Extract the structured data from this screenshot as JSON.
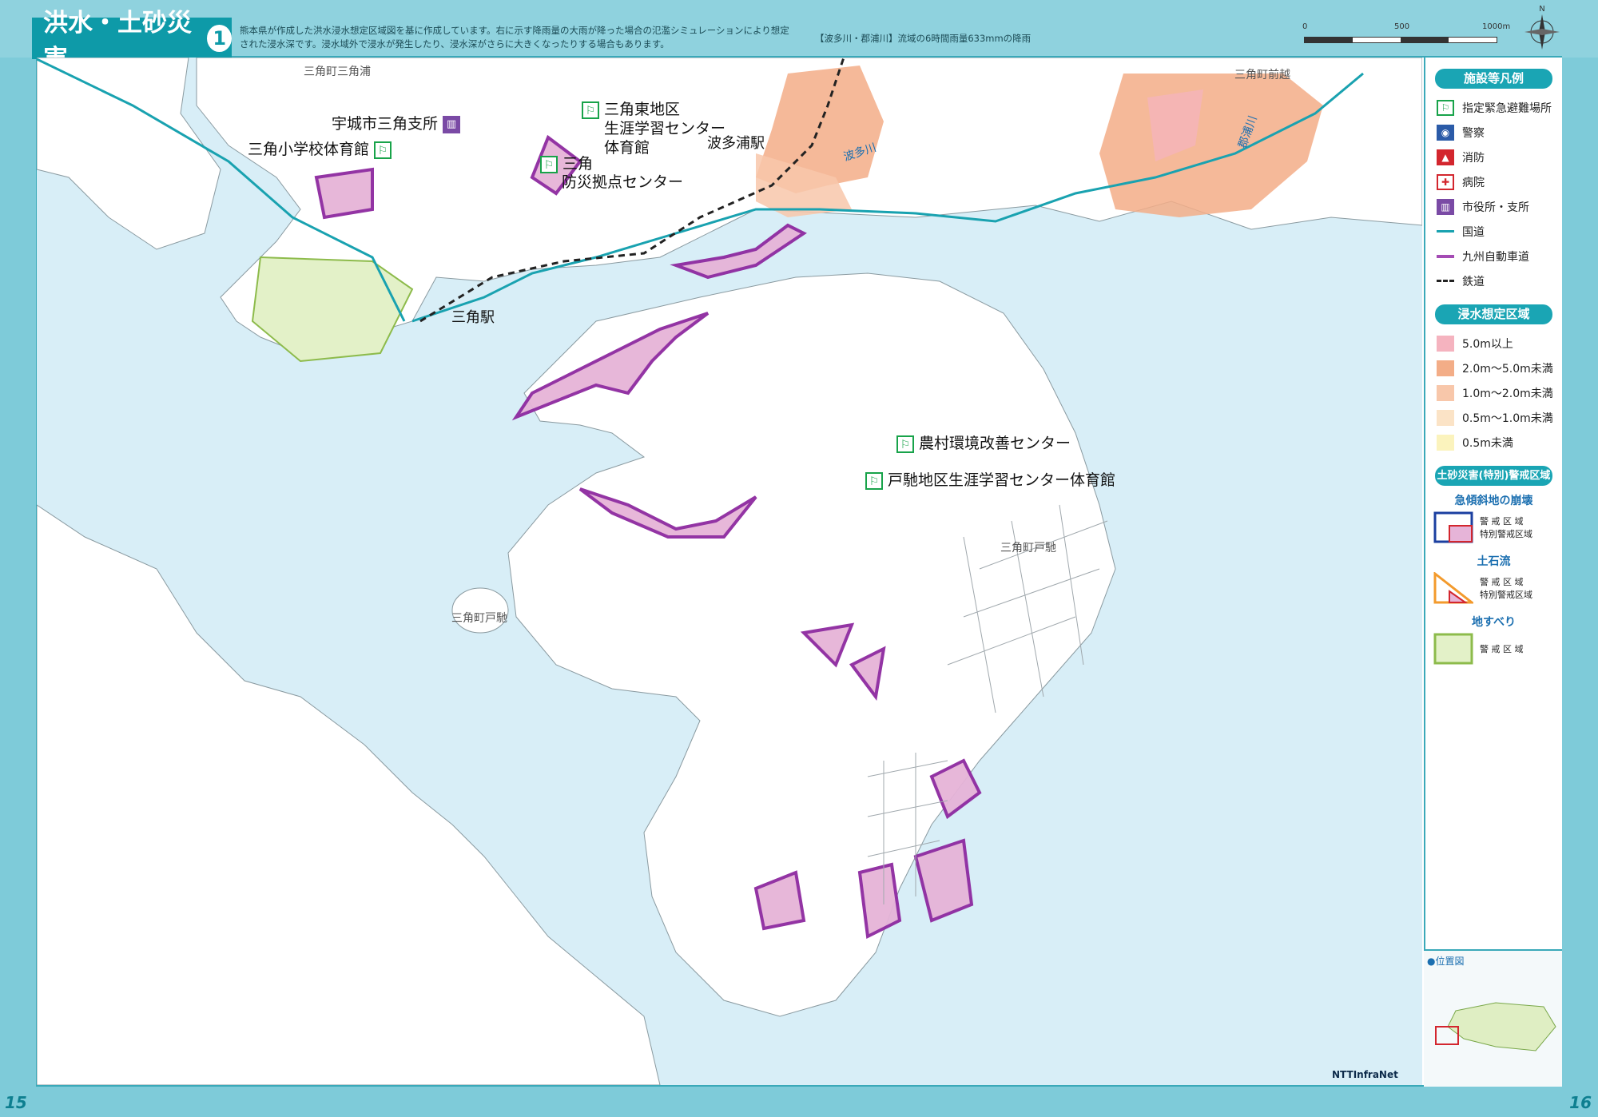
{
  "header": {
    "title": "洪水・土砂災害",
    "title_number": "1",
    "description": "熊本県が作成した洪水浸水想定区域図を基に作成しています。右に示す降雨量の大雨が降った場合の氾濫シミュレーションにより想定された浸水深です。浸水域外で浸水が発生したり、浸水深がさらに大きくなったりする場合もあります。",
    "rainfall_note": "【波多川・郡浦川】流域の6時間雨量633mmの降雨",
    "scale_labels": [
      "0",
      "500",
      "1000m"
    ],
    "north_label": "N"
  },
  "map": {
    "water_color": "#d8eef7",
    "land_color": "#ffffff",
    "labels": {
      "sumiyoshi_misumiura": "三角町三角浦",
      "city_office": "宇城市三角支所",
      "misumi_gym": "三角小学校体育館",
      "misumi_east": "三角東地区",
      "misumi_east2": "生涯学習センター",
      "misumi_east3": "体育館",
      "hatauranavi_station": "波多浦駅",
      "bosai": "三角",
      "bosai2": "防災拠点センター",
      "misumi_station": "三角駅",
      "hata_river": "波多川",
      "kouraura_river": "郡浦川",
      "maekoshi": "三角町前越",
      "noson": "農村環境改善センター",
      "tobase_gym": "戸馳地区生涯学習センター体育館",
      "tobase": "三角町戸馳",
      "tobase_island": "三角町戸馳"
    }
  },
  "legend": {
    "facilities_head": "施設等凡例",
    "facilities": [
      {
        "name": "evacuation-icon",
        "label": "指定緊急避難場所"
      },
      {
        "name": "police-icon",
        "label": "警察"
      },
      {
        "name": "fire-icon",
        "label": "消防"
      },
      {
        "name": "hospital-icon",
        "label": "病院"
      },
      {
        "name": "city-office-icon",
        "label": "市役所・支所"
      },
      {
        "name": "national-road-line",
        "label": "国道"
      },
      {
        "name": "expressway-line",
        "label": "九州自動車道"
      },
      {
        "name": "railway-line",
        "label": "鉄道"
      }
    ],
    "flood_head": "浸水想定区域",
    "flood": [
      {
        "label": "5.0m以上",
        "color": "#f5b3bf"
      },
      {
        "label": "2.0m〜5.0m未満",
        "color": "#f3ad87"
      },
      {
        "label": "1.0m〜2.0m未満",
        "color": "#f8c7aa"
      },
      {
        "label": "0.5m〜1.0m未満",
        "color": "#fbe3c6"
      },
      {
        "label": "0.5m未満",
        "color": "#fbf3bd"
      }
    ],
    "sediment_head": "土砂災害(特別)警戒区域",
    "steep_slope": "急傾斜地の崩壊",
    "debris_flow": "土石流",
    "landslide": "地すべり",
    "warn_zone": "警 戒 区 域",
    "special_zone": "特別警戒区域",
    "location_label": "●位置図"
  },
  "pages": {
    "left": "15",
    "right": "16"
  },
  "brand": "NTTInfraNet"
}
